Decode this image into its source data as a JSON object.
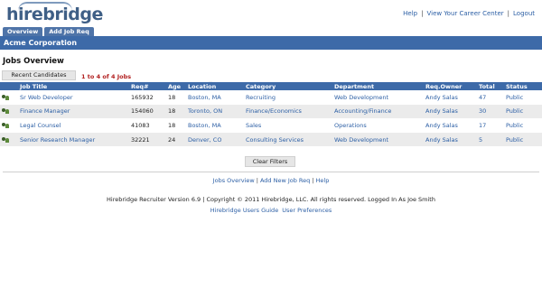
{
  "app": {
    "logo_text": "hirebridge"
  },
  "top_links": {
    "help": "Help",
    "view_career_center": "View Your Career Center",
    "logout": "Logout"
  },
  "tabs": [
    {
      "label": "Overview"
    },
    {
      "label": "Add Job Req"
    }
  ],
  "company": {
    "name": "Acme Corporation"
  },
  "page": {
    "title": "Jobs Overview",
    "recent_candidates_label": "Recent Candidates",
    "count_text": "1 to 4 of 4 Jobs",
    "clear_filters_label": "Clear Filters"
  },
  "table": {
    "columns": [
      "Job Title",
      "Req#",
      "Age",
      "Location",
      "Category",
      "Department",
      "Req.Owner",
      "Total",
      "Status"
    ],
    "rows": [
      {
        "title": "Sr Web Developer",
        "req": "165932",
        "age": "18",
        "location": "Boston, MA",
        "category": "Recruiting",
        "department": "Web Development",
        "owner": "Andy Salas",
        "total": "47",
        "status": "Public"
      },
      {
        "title": "Finance Manager",
        "req": "154060",
        "age": "18",
        "location": "Toronto, ON",
        "category": "Finance/Economics",
        "department": "Accounting/Finance",
        "owner": "Andy Salas",
        "total": "30",
        "status": "Public"
      },
      {
        "title": "Legal Counsel",
        "req": "41083",
        "age": "18",
        "location": "Boston, MA",
        "category": "Sales",
        "department": "Operations",
        "owner": "Andy Salas",
        "total": "17",
        "status": "Public"
      },
      {
        "title": "Senior Research Manager",
        "req": "32221",
        "age": "24",
        "location": "Denver, CO",
        "category": "Consulting Services",
        "department": "Web Development",
        "owner": "Andy Salas",
        "total": "5",
        "status": "Public"
      }
    ]
  },
  "footer": {
    "jobs_overview": "Jobs Overview",
    "add_new_job_req": "Add New Job Req",
    "help": "Help",
    "copyright": "Hirebridge Recruiter Version 6.9 | Copyright © 2011 Hirebridge, LLC. All rights reserved. Logged In As Joe Smith",
    "users_guide": "Hirebridge Users Guide",
    "user_preferences": "User Preferences"
  },
  "colors": {
    "brand_blue": "#3d6aa8",
    "link_blue": "#2c5fa5",
    "count_red": "#b22222",
    "row_alt": "#ebebeb"
  }
}
